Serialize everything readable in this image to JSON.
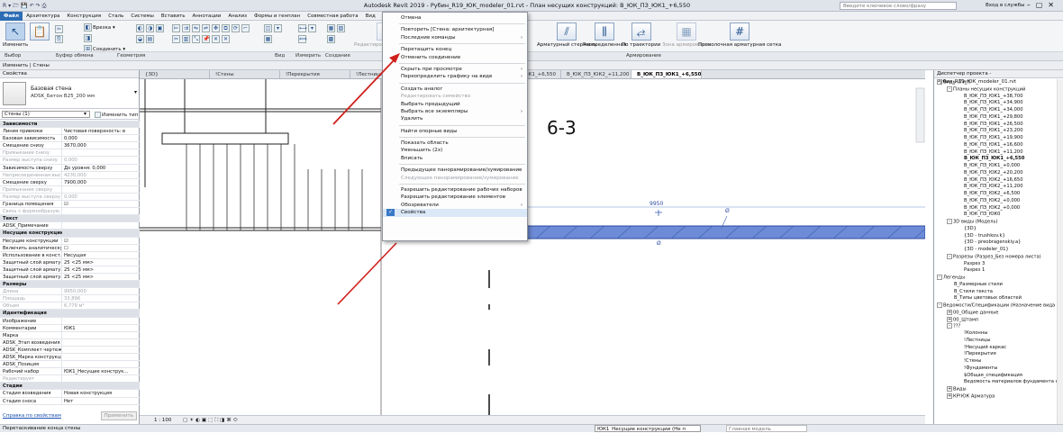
{
  "title": {
    "app": "Autodesk Revit 2019 - Рубин_R19_ЮК_modeler_01.rvt - План несущих конструкций: В_ЮК_ПЗ_ЮК1_+6,550",
    "search_placeholder": "Введите ключевое слово/фразу",
    "sign_in": "Вход в службы"
  },
  "menubar": [
    "Файл",
    "Архитектура",
    "Конструкция",
    "Сталь",
    "Системы",
    "Вставить",
    "Аннотации",
    "Анализ",
    "Формы и генплан",
    "Совместная работа",
    "Вид",
    "Управление"
  ],
  "ribbon": {
    "modify": "Изменить",
    "select": "Выбор",
    "clipboard": "Буфер обмена",
    "geometry": "Геометрия",
    "cut": "Врезка",
    "join": "Соединить",
    "view_group": "Вид",
    "measure": "Измерить",
    "create": "Создание",
    "edit_profile": "Редактировать профиль",
    "rebar_bar": "Арматурный стержень",
    "distribution": "Распределенная",
    "path": "По траектории",
    "area": "Зона армирования",
    "wire": "Проволочная арматурная сетка",
    "rebar_group": "Армирование"
  },
  "optbar": "Изменить | Стены",
  "tabs": [
    "{3D}",
    "!Стены",
    "!Перекрытия",
    "!Лестницы",
    "В_ЮК_ПЗ_ЮК0",
    "В_ЮК_ПЗ_ЮК1_+6,550",
    "В_ЮК_ПЗ_ЮК2_+11,200",
    "В_ЮК_ПЗ_ЮК1_+6,550"
  ],
  "props": {
    "header": "Свойства",
    "type_name": "Базовая стена",
    "type_sub": "ADSK_Бетон В25_200 мм",
    "filter": "Стены (1)",
    "edit_type": "Изменить тип",
    "rows": [
      {
        "k": "Зависимости",
        "g": true
      },
      {
        "k": "Линия привязки",
        "v": "Чистовая поверхность: в"
      },
      {
        "k": "Базовая зависимость",
        "v": "0,000"
      },
      {
        "k": "Смещение снизу",
        "v": "3670,000"
      },
      {
        "k": "Примыкание снизу",
        "v": "",
        "d": true
      },
      {
        "k": "Размер выступа снизу",
        "v": "0,000",
        "d": true
      },
      {
        "k": "Зависимость сверху",
        "v": "До уровня: 0,000"
      },
      {
        "k": "Неприсоединенная выс...",
        "v": "4230,000",
        "d": true
      },
      {
        "k": "Смещение сверху",
        "v": "7900,000"
      },
      {
        "k": "Примыкание сверху",
        "v": "",
        "d": true
      },
      {
        "k": "Размер выступа сверху",
        "v": "0,000",
        "d": true
      },
      {
        "k": "Граница помещения",
        "v": "☑"
      },
      {
        "k": "Связь с формообразую...",
        "v": "",
        "d": true
      },
      {
        "k": "Текст",
        "g": true
      },
      {
        "k": "ADSK_Примечание",
        "v": ""
      },
      {
        "k": "Несущие конструкции",
        "g": true
      },
      {
        "k": "Несущие конструкции",
        "v": "☑"
      },
      {
        "k": "Включить аналитическу...",
        "v": "☐"
      },
      {
        "k": "Использование в конст...",
        "v": "Несущая"
      },
      {
        "k": "Защитный слой армату...",
        "v": "25 <25 мм>"
      },
      {
        "k": "Защитный слой армату...",
        "v": "25 <25 мм>"
      },
      {
        "k": "Защитный слой армату...",
        "v": "25 <25 мм>"
      },
      {
        "k": "Размеры",
        "g": true
      },
      {
        "k": "Длина",
        "v": "9950,000",
        "d": true
      },
      {
        "k": "Площадь",
        "v": "33,896",
        "d": true
      },
      {
        "k": "Объем",
        "v": "6,779 м³",
        "d": true
      },
      {
        "k": "Идентификация",
        "g": true
      },
      {
        "k": "Изображение",
        "v": ""
      },
      {
        "k": "Комментарии",
        "v": "ЮК1"
      },
      {
        "k": "Марка",
        "v": ""
      },
      {
        "k": "ADSK_Этап возведения",
        "v": ""
      },
      {
        "k": "ADSK_Комплект чертежей",
        "v": ""
      },
      {
        "k": "ADSK_Марка конструкции",
        "v": ""
      },
      {
        "k": "ADSK_Позиция",
        "v": ""
      },
      {
        "k": "Рабочий набор",
        "v": "ЮК1_Несущие конструк..."
      },
      {
        "k": "Редактирует",
        "v": "",
        "d": true
      },
      {
        "k": "Стадии",
        "g": true
      },
      {
        "k": "Стадия возведения",
        "v": "Новая конструкция"
      },
      {
        "k": "Стадия сноса",
        "v": "Нет"
      }
    ],
    "help": "Справка по свойствам",
    "apply": "Применить"
  },
  "canvas": {
    "section_label": "6-3",
    "dim_value": "9950",
    "dim_tag": "Ø",
    "level_mark": "Ø"
  },
  "viewbar": {
    "scale": "1 : 100"
  },
  "menu": [
    {
      "label": "Отмена"
    },
    {
      "sep": true
    },
    {
      "label": "Повторить [Стена: архитектурная]"
    },
    {
      "label": "Последние команды",
      "sub": true
    },
    {
      "sep": true
    },
    {
      "label": "Перетащить конец"
    },
    {
      "label": "Отменить соединение"
    },
    {
      "sep": true
    },
    {
      "label": "Скрыть при просмотре",
      "sub": true
    },
    {
      "label": "Переопределить графику на виде",
      "sub": true
    },
    {
      "sep": true
    },
    {
      "label": "Создать аналог"
    },
    {
      "label": "Редактировать семейство",
      "dis": true
    },
    {
      "label": "Выбрать предыдущий"
    },
    {
      "label": "Выбрать все экземпляры",
      "sub": true
    },
    {
      "label": "Удалить"
    },
    {
      "sep": true
    },
    {
      "label": "Найти опорные виды"
    },
    {
      "sep": true
    },
    {
      "label": "Показать область"
    },
    {
      "label": "Уменьшить (2x)"
    },
    {
      "label": "Вписать"
    },
    {
      "sep": true
    },
    {
      "label": "Предыдущее панорамирование/зумирование"
    },
    {
      "label": "Следующее панорамирование/зумирование",
      "dis": true
    },
    {
      "sep": true
    },
    {
      "label": "Разрешить редактирование рабочих наборов"
    },
    {
      "label": "Разрешить редактирование элементов"
    },
    {
      "label": "Обозреватели",
      "sub": true
    },
    {
      "label": "Свойства",
      "checked": true
    }
  ],
  "browser": {
    "header": "Диспетчер проекта - Рубин_R19_ЮК_modeler_01.rvt",
    "items": [
      {
        "t": "Виды (Тип)",
        "l": 0,
        "e": "-"
      },
      {
        "t": "Планы несущих конструкций",
        "l": 1,
        "e": "-"
      },
      {
        "t": "В_ЮК_ПЗ_ЮК1_+38,700",
        "l": 2
      },
      {
        "t": "В_ЮК_ПЗ_ЮК1_+34,900",
        "l": 2
      },
      {
        "t": "В_ЮК_ПЗ_ЮК1_+34,000",
        "l": 2
      },
      {
        "t": "В_ЮК_ПЗ_ЮК1_+29,800",
        "l": 2
      },
      {
        "t": "В_ЮК_ПЗ_ЮК1_+26,500",
        "l": 2
      },
      {
        "t": "В_ЮК_ПЗ_ЮК1_+23,200",
        "l": 2
      },
      {
        "t": "В_ЮК_ПЗ_ЮК1_+19,900",
        "l": 2
      },
      {
        "t": "В_ЮК_ПЗ_ЮК1_+16,600",
        "l": 2
      },
      {
        "t": "В_ЮК_ПЗ_ЮК1_+11,200",
        "l": 2
      },
      {
        "t": "В_ЮК_ПЗ_ЮК1_+6,550",
        "l": 2,
        "b": true
      },
      {
        "t": "В_ЮК_ПЗ_ЮК1_+0,000",
        "l": 2
      },
      {
        "t": "В_ЮК_ПЗ_ЮК2_+20,200",
        "l": 2
      },
      {
        "t": "В_ЮК_ПЗ_ЮК2_+16,650",
        "l": 2
      },
      {
        "t": "В_ЮК_ПЗ_ЮК2_+11,200",
        "l": 2
      },
      {
        "t": "В_ЮК_ПЗ_ЮК2_+6,500",
        "l": 2
      },
      {
        "t": "В_ЮК_ПЗ_ЮК2_+0,000",
        "l": 2
      },
      {
        "t": "В_ЮК_ПЗ_ЮК2_+0,000",
        "l": 2
      },
      {
        "t": "В_ЮК_ПЗ_ЮК0",
        "l": 2
      },
      {
        "t": "3D виды (Модель)",
        "l": 1,
        "e": "-"
      },
      {
        "t": "{3D}",
        "l": 2
      },
      {
        "t": "{3D - trushkov.k}",
        "l": 2
      },
      {
        "t": "{3D - preobragenskiy.a}",
        "l": 2
      },
      {
        "t": "{3D - modeler_01}",
        "l": 2
      },
      {
        "t": "Разрезы (Разрез_Без номера листа)",
        "l": 1,
        "e": "-"
      },
      {
        "t": "Разрез 3",
        "l": 2
      },
      {
        "t": "Разрез 1",
        "l": 2
      },
      {
        "t": "Легенды",
        "l": 0,
        "e": "-"
      },
      {
        "t": "В_Размерные стили",
        "l": 1
      },
      {
        "t": "В_Стили текста",
        "l": 1
      },
      {
        "t": "В_Типы цветовых областей",
        "l": 1
      },
      {
        "t": "Ведомости/Спецификации (Назначение вида",
        "l": 0,
        "e": "-"
      },
      {
        "t": "00_Общие данные",
        "l": 1,
        "e": "+"
      },
      {
        "t": "00_Штамп",
        "l": 1,
        "e": "+"
      },
      {
        "t": "???",
        "l": 1,
        "e": "-"
      },
      {
        "t": "!Колонны",
        "l": 2
      },
      {
        "t": "!Лестницы",
        "l": 2
      },
      {
        "t": "!Несущий каркас",
        "l": 2
      },
      {
        "t": "!Перекрытия",
        "l": 2
      },
      {
        "t": "!Стены",
        "l": 2
      },
      {
        "t": "!Фундаменты",
        "l": 2
      },
      {
        "t": "$Общая_спецификация",
        "l": 2
      },
      {
        "t": "Ведомость материалов фундамента неса",
        "l": 2
      },
      {
        "t": "Виды",
        "l": 1,
        "e": "+"
      },
      {
        "t": "КР!ЮК Арматура",
        "l": 1,
        "e": "+"
      }
    ]
  },
  "status": {
    "text": "Перетаскивание конца стены",
    "workset": "ЮК1_Несущие конструкции (Не п",
    "main_model": "Главная модель"
  }
}
